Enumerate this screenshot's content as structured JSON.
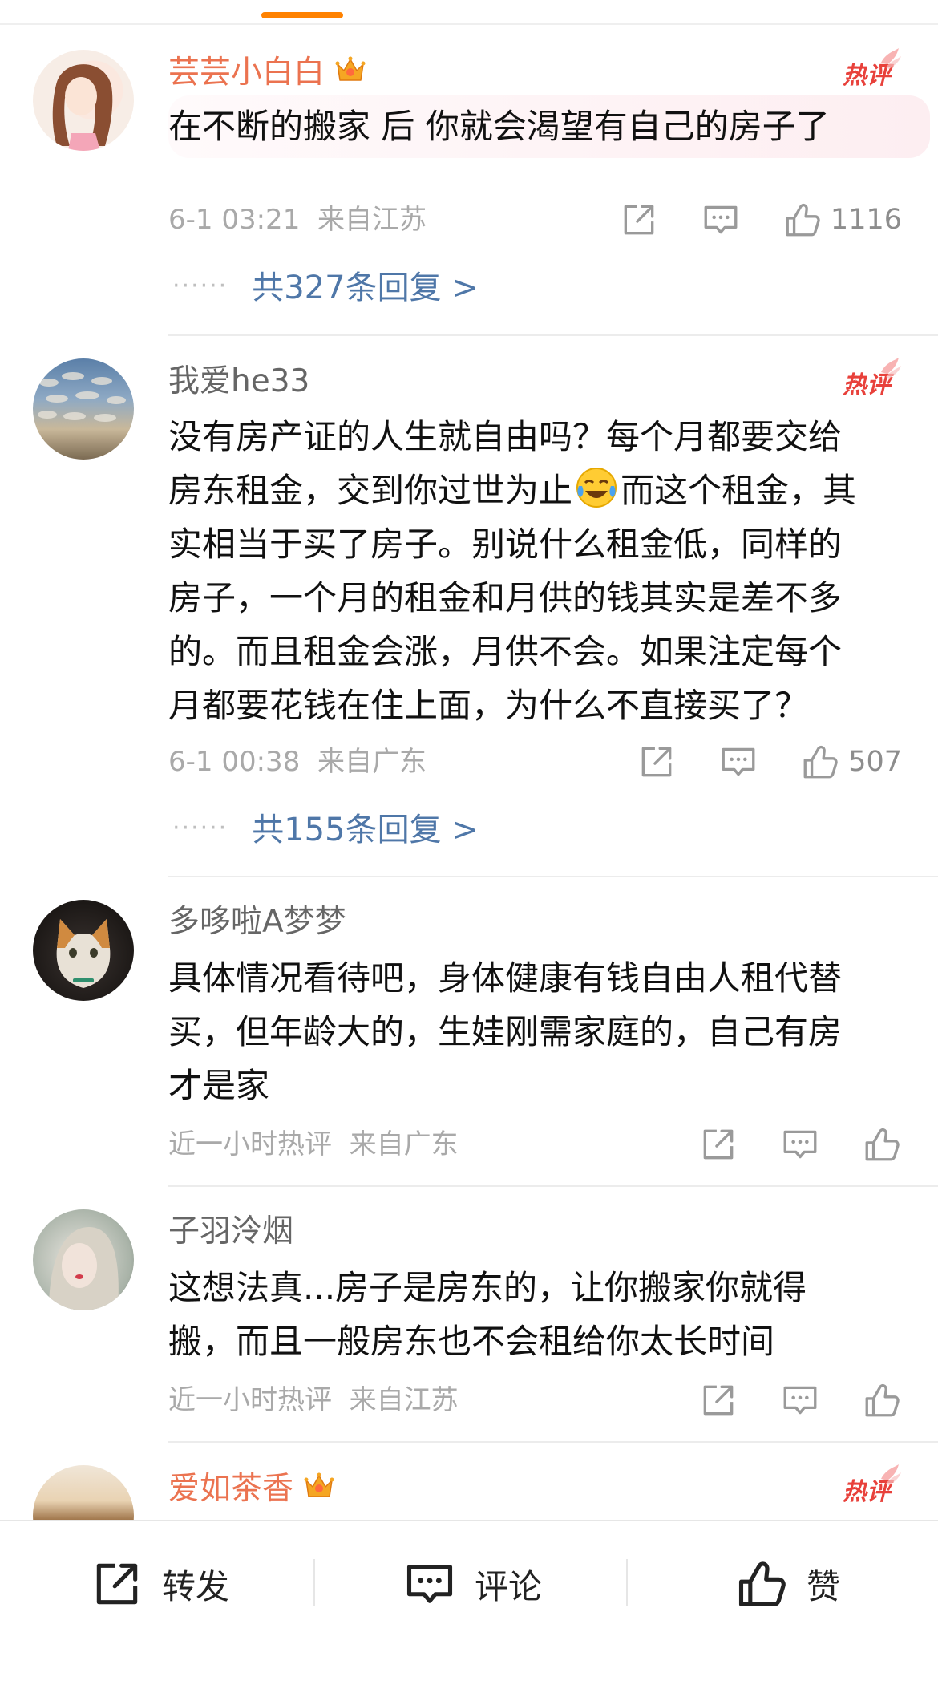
{
  "comments": [
    {
      "name": "芸芸小白白",
      "vip": true,
      "hot": true,
      "text_lines": [
        "在不断的搬家 后 你就会渴望有自己的房子了"
      ],
      "time": "6-1 03:21",
      "location": "来自江苏",
      "likes": "1116",
      "replies_label": "共327条回复 >"
    },
    {
      "name": "我爱he33",
      "vip": false,
      "hot": true,
      "text_lines": [
        "没有房产证的人生就自由吗？每个月都要交给",
        "房东租金，交到你过世为止",
        "而这个租金，其",
        "实相当于买了房子。别说什么租金低，同样的",
        "房子，一个月的租金和月供的钱其实是差不多",
        "的。而且租金会涨，月供不会。如果注定每个",
        "月都要花钱在住上面，为什么不直接买了？"
      ],
      "time": "6-1 00:38",
      "location": "来自广东",
      "likes": "507",
      "replies_label": "共155条回复 >"
    },
    {
      "name": "多哆啦A梦梦",
      "vip": false,
      "hot": false,
      "text_lines": [
        "具体情况看待吧，身体健康有钱自由人租代替",
        "买，但年龄大的，生娃刚需家庭的，自己有房",
        "才是家"
      ],
      "time": "近一小时热评",
      "location": "来自广东"
    },
    {
      "name": "子羽泠烟",
      "vip": false,
      "hot": false,
      "text_lines": [
        "这想法真...房子是房东的，让你搬家你就得",
        "搬，而且一般房东也不会租给你太长时间"
      ],
      "time": "近一小时热评",
      "location": "来自江苏"
    },
    {
      "name": "爱如茶香",
      "vip": true,
      "hot": true
    }
  ],
  "icons": {
    "hot_badge": "hot-comment-badge-icon",
    "crown": "vip-crown-icon",
    "share": "share-icon",
    "comment": "comment-icon",
    "like": "thumbs-up-icon",
    "emoji": "laugh-cry-emoji"
  },
  "bottom_bar": {
    "repost": "转发",
    "comment": "评论",
    "like": "赞"
  },
  "colors": {
    "accent": "#ff8200",
    "vip_name": "#eb7350",
    "reply_link": "#4f77a8",
    "hot_badge": "#e8413b"
  }
}
